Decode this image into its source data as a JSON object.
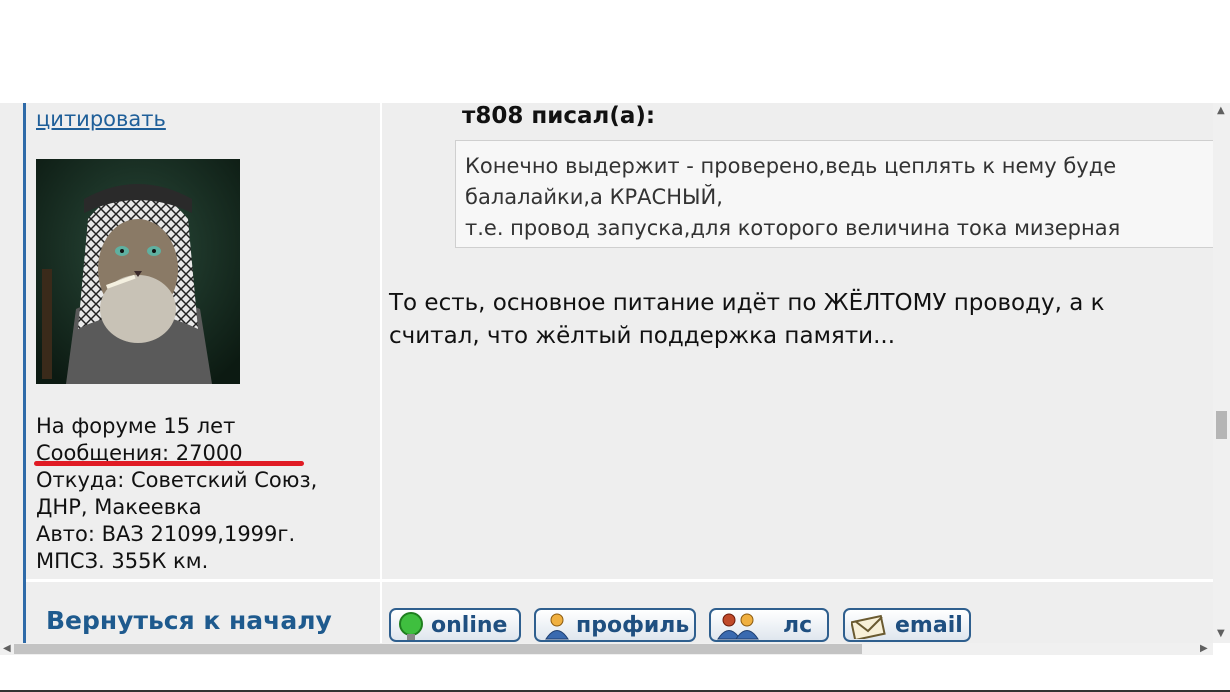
{
  "sidebar": {
    "quote_link": "цитировать",
    "on_forum": "На форуме 15 лет",
    "messages": "Сообщения: 27000",
    "from_line1": "Откуда: Советский Союз,",
    "from_line2": "ДНР, Макеевка",
    "auto_line1": "Авто: ВАЗ 21099,1999г.",
    "auto_line2": "МПСЗ. 355К км.",
    "back_to_top": "Вернуться к началу"
  },
  "post": {
    "quote_author": "т808 писал(а):",
    "quote_lines": [
      "Конечно выдержит - проверено,ведь цеплять к нему буде",
      "балалайки,а КРАСНЫЙ,",
      "т.е. провод запуска,для которого величина тока мизерная"
    ],
    "body_lines": [
      "То есть, основное питание идёт по ЖЁЛТОМУ проводу, а к",
      "считал, что жёлтый поддержка памяти..."
    ]
  },
  "buttons": {
    "online": "online",
    "profile": "профиль",
    "pm": "лс",
    "email": "email"
  },
  "icons": {
    "online": "green-bulb-icon",
    "profile": "user-icon",
    "pm": "users-icon",
    "email": "envelope-icon"
  },
  "colors": {
    "link": "#1f5f99",
    "accent": "#2e6aa8",
    "underline_mark": "#e01b24"
  }
}
